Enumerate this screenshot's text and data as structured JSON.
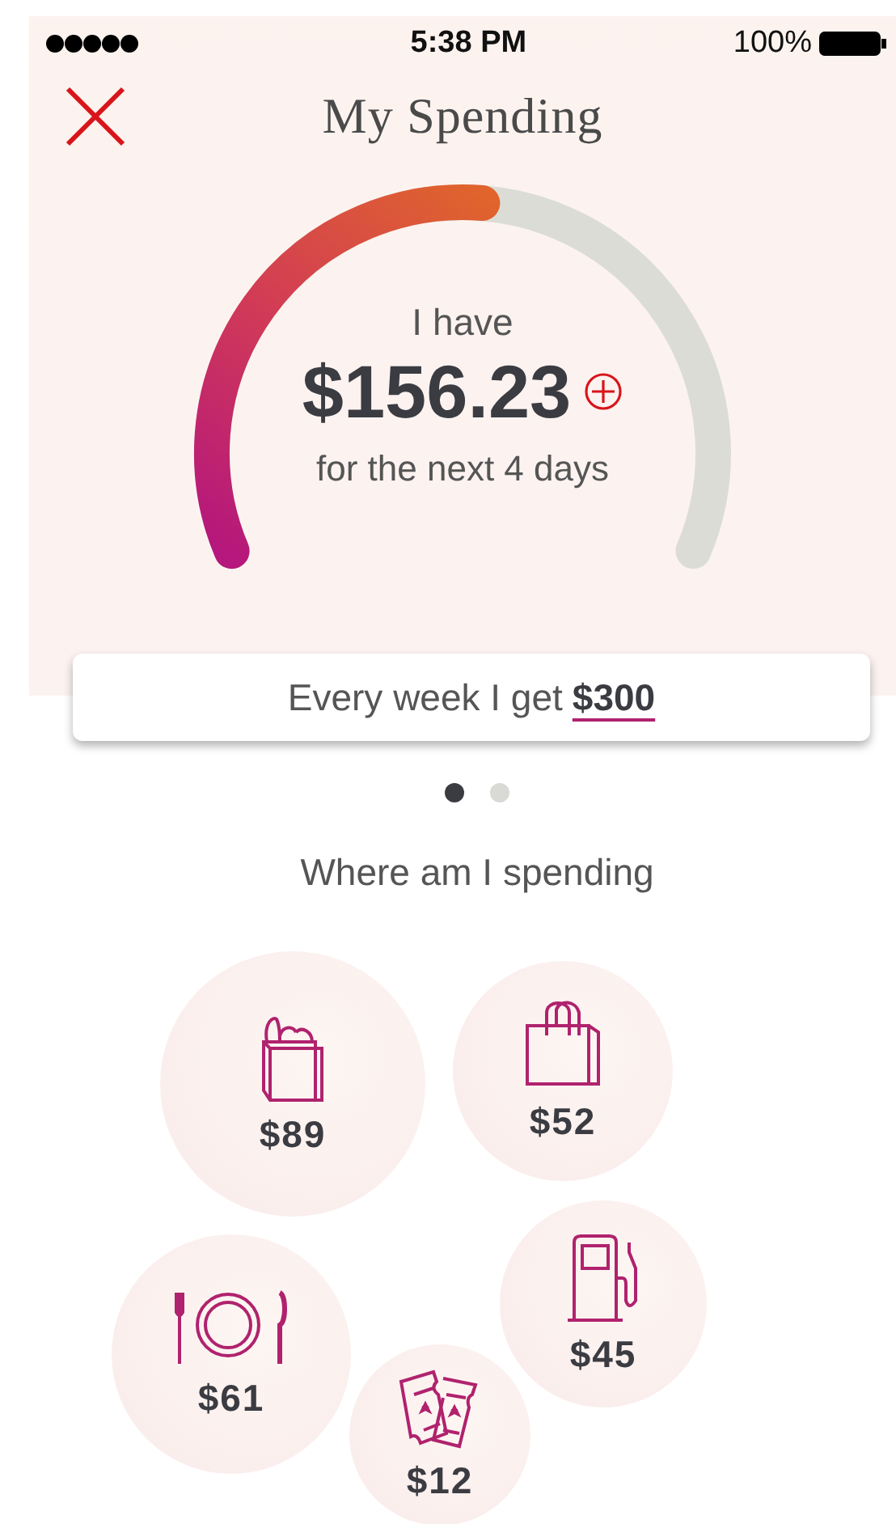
{
  "status_bar": {
    "time": "5:38 PM",
    "battery": "100%"
  },
  "header": {
    "title": "My Spending"
  },
  "gauge": {
    "label": "I have",
    "amount": "$156.23",
    "subtitle": "for the next 4 days"
  },
  "budget": {
    "text": "Every week I get",
    "amount": "$300"
  },
  "page_dots": [
    {
      "selected": true
    },
    {
      "selected": false
    }
  ],
  "section_title": "Where am I spending",
  "categories": [
    {
      "kind": "groceries",
      "amount": "$89"
    },
    {
      "kind": "shopping",
      "amount": "$52"
    },
    {
      "kind": "dining",
      "amount": "$61"
    },
    {
      "kind": "fuel",
      "amount": "$45"
    },
    {
      "kind": "entertainment",
      "amount": "$12"
    }
  ]
}
